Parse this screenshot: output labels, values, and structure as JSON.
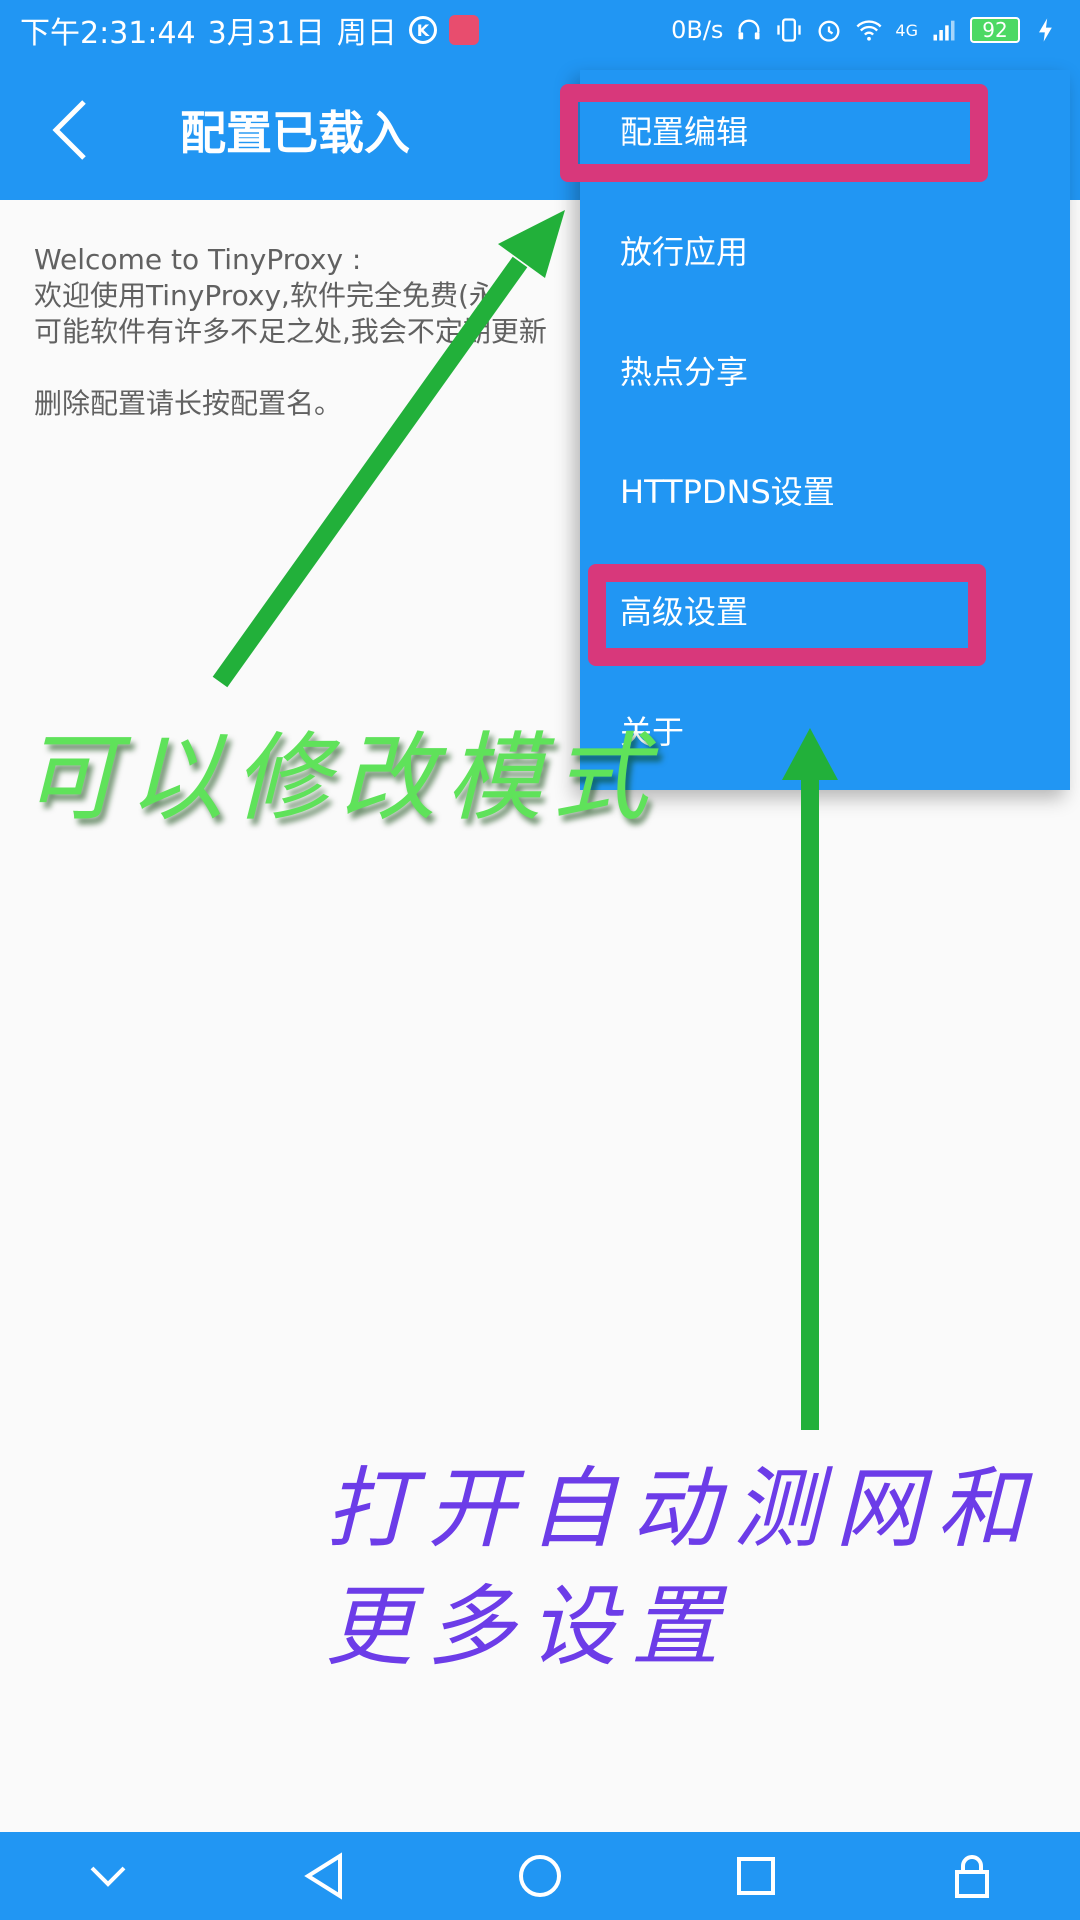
{
  "status_bar": {
    "time": "下午2:31:44",
    "date": "3月31日",
    "weekday": "周日",
    "net_speed": "0B/s",
    "network_type": "4G",
    "battery": "92"
  },
  "app_bar": {
    "title": "配置已载入"
  },
  "content": {
    "lines": [
      "Welcome to TinyProxy :",
      "欢迎使用TinyProxy,软件完全免费(永",
      "可能软件有许多不足之处,我会不定期更新"
    ],
    "hint": "删除配置请长按配置名。"
  },
  "menu": {
    "items": [
      {
        "label": "配置编辑"
      },
      {
        "label": "放行应用"
      },
      {
        "label": "热点分享"
      },
      {
        "label": "HTTPDNS设置"
      },
      {
        "label": "高级设置"
      },
      {
        "label": "关于"
      }
    ]
  },
  "annotations": {
    "green_text": "可以修改模式",
    "purple_line1": "打开自动测网和",
    "purple_line2": "更多设置"
  },
  "colors": {
    "primary": "#2196f3",
    "highlight": "#d8387b",
    "arrow": "#22b03a",
    "annotation_green": "#5fe25a",
    "annotation_purple": "#6c3ce8"
  },
  "icons": {
    "status": [
      "k-icon",
      "app-badge-icon",
      "headphones-icon",
      "vibrate-icon",
      "alarm-icon",
      "wifi-icon",
      "signal-icon",
      "battery-icon",
      "charging-icon"
    ],
    "nav": [
      "chevron-down-icon",
      "back-triangle-icon",
      "home-circle-icon",
      "recents-square-icon",
      "lock-icon"
    ]
  }
}
